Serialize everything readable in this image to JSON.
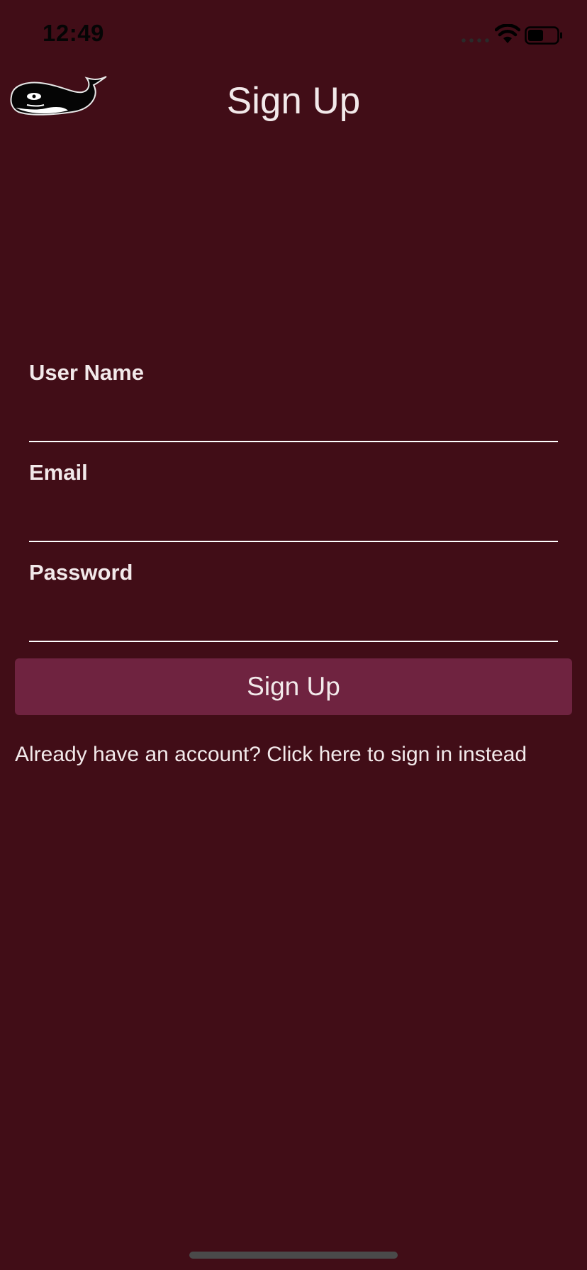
{
  "status_bar": {
    "time": "12:49",
    "wifi_icon": "wifi-icon",
    "battery_icon": "battery-icon",
    "signal_icon": "signal-dots-icon"
  },
  "header": {
    "title": "Sign Up",
    "logo_icon": "whale-logo-icon"
  },
  "form": {
    "fields": [
      {
        "label": "User Name",
        "value": ""
      },
      {
        "label": "Email",
        "value": ""
      },
      {
        "label": "Password",
        "value": ""
      }
    ],
    "submit_label": "Sign Up",
    "signin_link": "Already have an account? Click here to sign in instead"
  },
  "colors": {
    "background": "#410d17",
    "button": "#6f2340",
    "text": "#f2e9ea",
    "input_underline": "#ffffff"
  }
}
